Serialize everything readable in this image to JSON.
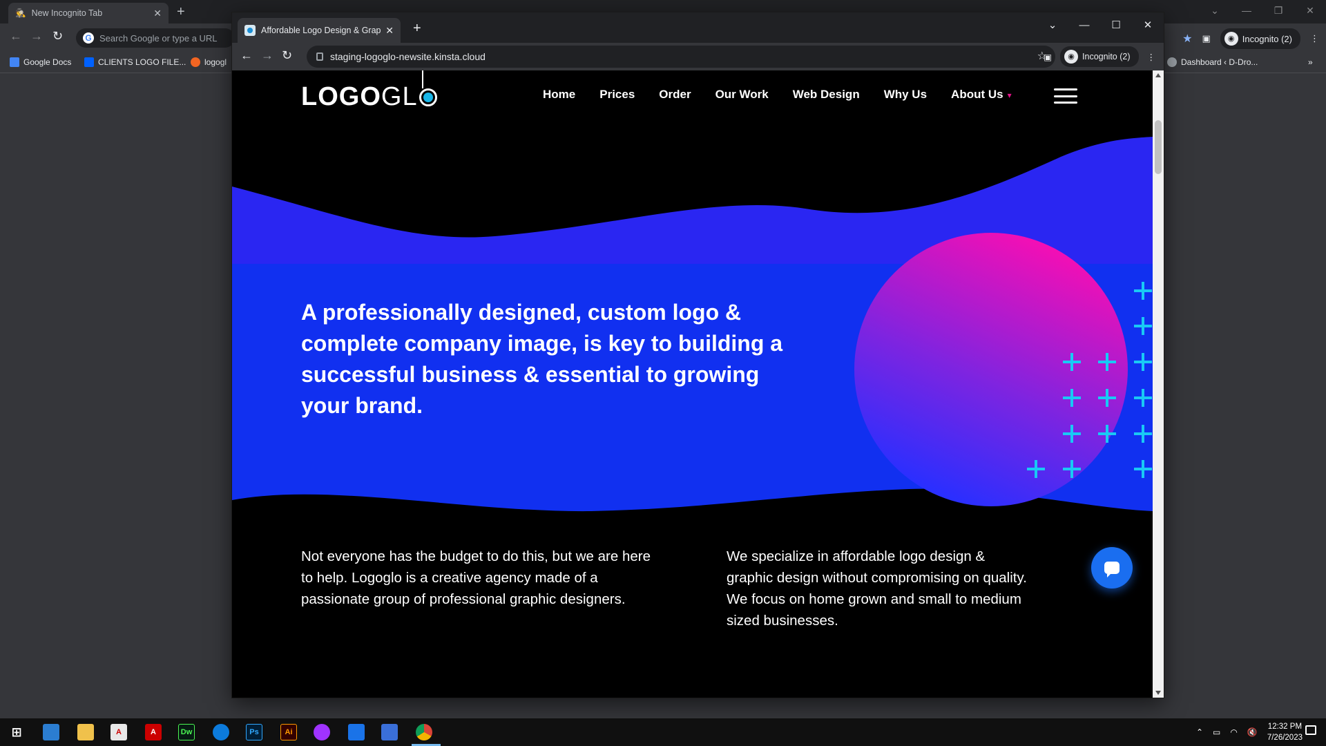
{
  "bg_browser": {
    "tab_title": "New Incognito Tab",
    "omnibox_placeholder": "Search Google or type a URL",
    "incognito_label": "Incognito (2)",
    "bookmarks": [
      "Google Docs",
      "CLIENTS LOGO FILE...",
      "logogl",
      "Dashboard ‹ D-Dro..."
    ],
    "more_bookmarks": "»"
  },
  "fg_browser": {
    "tab_title": "Affordable Logo Design & Graph",
    "url": "staging-logoglo-newsite.kinsta.cloud",
    "incognito_label": "Incognito (2)"
  },
  "site": {
    "logo_bold": "LOGO",
    "logo_light": "GL",
    "nav": [
      "Home",
      "Prices",
      "Order",
      "Our Work",
      "Web Design",
      "Why Us",
      "About Us"
    ],
    "hero_headline": "A professionally designed, custom logo & complete company image, is key to building a successful business & essential to growing your brand.",
    "intro_left": "Not everyone has the budget to do this, but we are here to help. Logoglo is a creative agency made of a passionate group of professional graphic designers.",
    "intro_right": "We specialize in affordable logo design & graphic design without compromising on quality. We focus on home grown and small to medium sized businesses."
  },
  "colors": {
    "hero_blue": "#1130f0",
    "wave_blue": "#2a26f2",
    "circle_top": "#f20fb5",
    "circle_bottom": "#2a2fff",
    "plus_cyan": "#19c9f5",
    "chat_blue": "#1a6ef0"
  },
  "taskbar": {
    "time": "12:32 PM",
    "date": "7/26/2023",
    "apps": [
      "windows-start",
      "explorer",
      "file-manager",
      "acrobat-reader",
      "acrobat",
      "dreamweaver",
      "edge",
      "photoshop",
      "illustrator",
      "messenger",
      "outlook",
      "remote-app",
      "chrome"
    ]
  }
}
